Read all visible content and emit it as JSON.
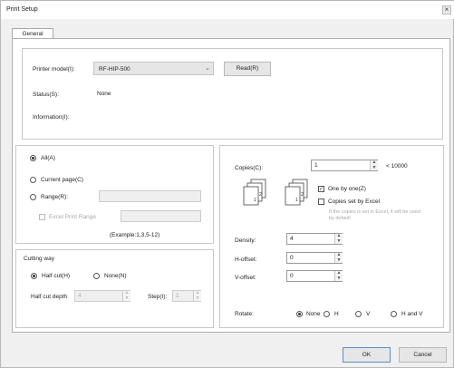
{
  "window": {
    "title": "Print Setup",
    "close_glyph": "×"
  },
  "tabs": [
    {
      "label": "General"
    }
  ],
  "printer": {
    "model_label": "Printer model(I):",
    "model_value": "RF-HIP-500",
    "read_label": "Read(R)",
    "status_label": "Status(S):",
    "status_value": "None",
    "information_label": "Information(I):"
  },
  "range": {
    "all_label": "All(A)",
    "current_label": "Current page(C)",
    "range_label": "Range(R):",
    "range_value": "",
    "excel_label": "Excel Print Range",
    "excel_value": "",
    "example": "(Example:1,3,5-12)",
    "selected": "all"
  },
  "cutting": {
    "group_label": "Cutting way",
    "half_cut_label": "Half cut(H)",
    "none_label": "None(N)",
    "selected": "half_cut",
    "half_cut_depth_label": "Half cut depth",
    "half_cut_depth_value": "4",
    "step_label": "Step(I):",
    "step_value": "1"
  },
  "copies": {
    "label": "Copies(C):",
    "value": "1",
    "max": "< 10000",
    "one_by_one_label": "One by one(Z)",
    "one_by_one_checked": true,
    "by_excel_label": "Copies set by Excel",
    "by_excel_checked": false,
    "note": "If the copies is set in Excel, it will be used by default"
  },
  "settings": {
    "density_label": "Density:",
    "density_value": "4",
    "h_offset_label": "H-offset:",
    "h_offset_value": "0",
    "v_offset_label": "V-offset:",
    "v_offset_value": "0"
  },
  "rotate": {
    "label": "Rotate:",
    "options": [
      "None",
      "H",
      "V",
      "H and V"
    ],
    "selected": "None"
  },
  "footer": {
    "ok_label": "OK",
    "cancel_label": "Cancel"
  },
  "icons": {
    "spin_up": "▲",
    "spin_down": "▼",
    "dropdown": "⌄",
    "check": "✓"
  },
  "colors": {
    "background": "#f0f0f0",
    "panel": "#ffffff",
    "border": "#c8c8c8",
    "input_border": "#999999"
  }
}
